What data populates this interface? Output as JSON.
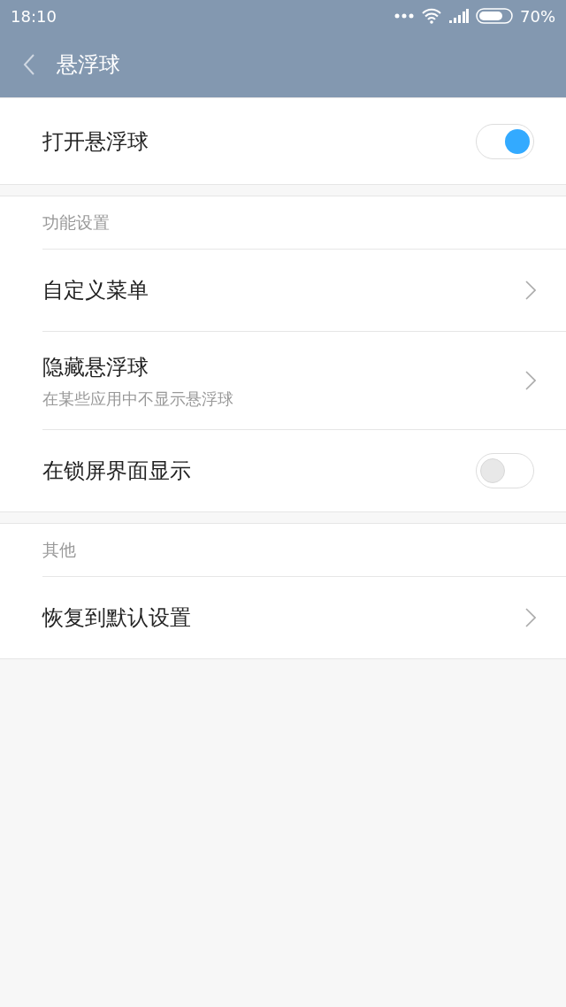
{
  "status_bar": {
    "time": "18:10",
    "battery": "70%"
  },
  "header": {
    "title": "悬浮球"
  },
  "sections": [
    {
      "items": [
        {
          "kind": "toggle",
          "label": "打开悬浮球",
          "on": true
        }
      ]
    },
    {
      "heading": "功能设置",
      "items": [
        {
          "kind": "link",
          "label": "自定义菜单"
        },
        {
          "kind": "link",
          "label": "隐藏悬浮球",
          "subtitle": "在某些应用中不显示悬浮球"
        },
        {
          "kind": "toggle",
          "label": "在锁屏界面显示",
          "on": false
        }
      ]
    },
    {
      "heading": "其他",
      "items": [
        {
          "kind": "link",
          "label": "恢复到默认设置"
        }
      ]
    }
  ]
}
